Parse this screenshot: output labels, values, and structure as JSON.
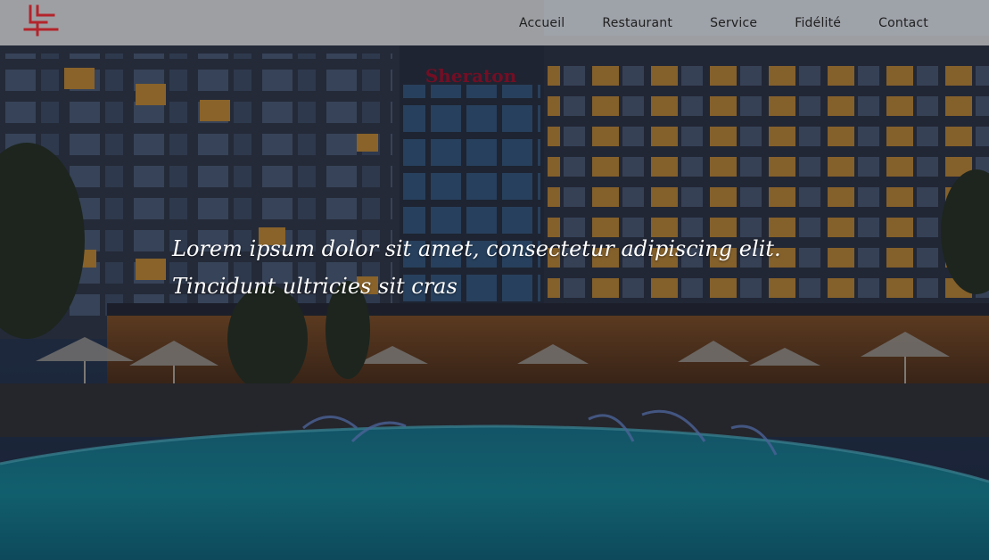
{
  "brand": {
    "logo_icon": "lp-monogram-logo",
    "logo_color": "#b3242b",
    "sign_text": "Sheraton",
    "sign_color": "#c8102e"
  },
  "nav": {
    "items": [
      {
        "label": "Accueil"
      },
      {
        "label": "Restaurant"
      },
      {
        "label": "Service"
      },
      {
        "label": "Fidélité"
      },
      {
        "label": "Contact"
      }
    ]
  },
  "hero": {
    "tagline": "Lorem ipsum dolor sit amet, consectetur adipiscing elit. Tincidunt ultricies sit cras",
    "image_subject": "hotel-pool-night-photo"
  },
  "colors": {
    "topbar_bg": "#cdcdcd",
    "nav_text": "#1f1f1f",
    "pool": "#1fa6b8",
    "window_light": "#f0a93a"
  }
}
